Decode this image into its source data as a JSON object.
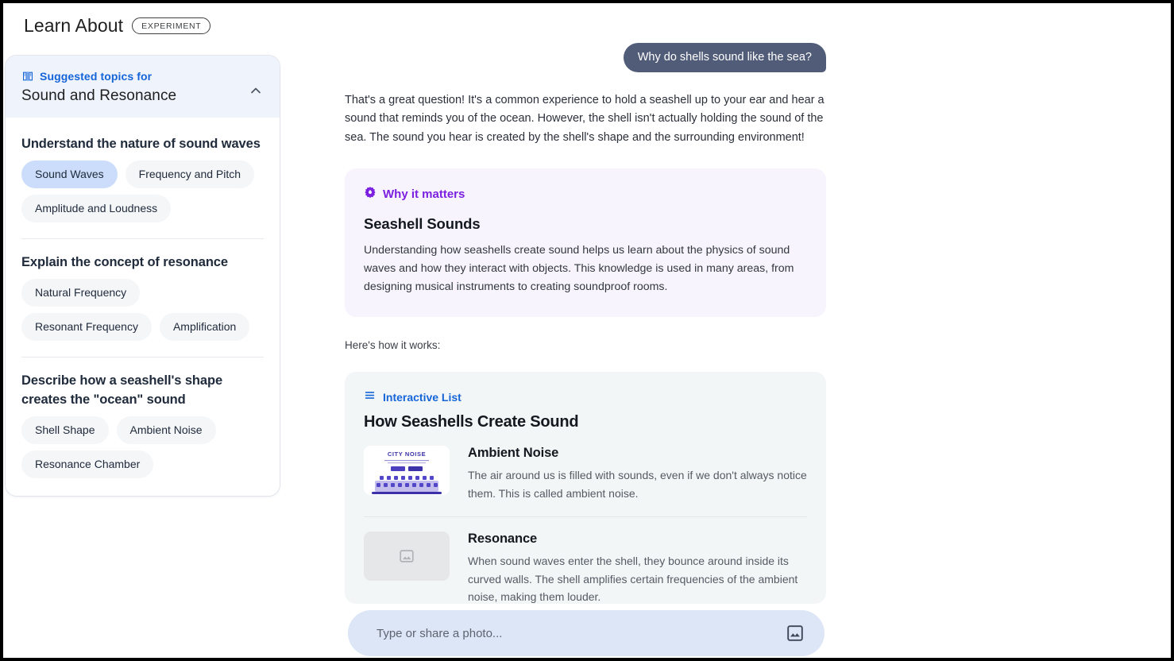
{
  "header": {
    "title": "Learn About",
    "badge": "EXPERIMENT"
  },
  "sidebar": {
    "eyebrow": "Suggested topics for",
    "eyebrow_icon": "menu-book-icon",
    "topic": "Sound and Resonance",
    "collapse_icon": "chevron-up-icon",
    "groups": [
      {
        "title": "Understand the nature of sound waves",
        "chips": [
          {
            "label": "Sound Waves",
            "selected": true
          },
          {
            "label": "Frequency and Pitch",
            "selected": false
          },
          {
            "label": "Amplitude and Loudness",
            "selected": false
          }
        ]
      },
      {
        "title": "Explain the concept of resonance",
        "chips": [
          {
            "label": "Natural Frequency",
            "selected": false
          },
          {
            "label": "Resonant Frequency",
            "selected": false
          },
          {
            "label": "Amplification",
            "selected": false
          }
        ]
      },
      {
        "title": "Describe how a seashell's shape creates the \"ocean\" sound",
        "chips": [
          {
            "label": "Shell Shape",
            "selected": false
          },
          {
            "label": "Ambient Noise",
            "selected": false
          },
          {
            "label": "Resonance Chamber",
            "selected": false
          }
        ]
      }
    ]
  },
  "conversation": {
    "user_message": "Why do shells sound like the sea?",
    "assistant_intro": "That's a great question! It's a common experience to hold a seashell up to your ear and hear a sound that reminds you of the ocean. However, the shell isn't actually holding the sound of the sea. The sound you hear is created by the shell's shape and the surrounding environment!",
    "transition": "Here's how it works:"
  },
  "why_card": {
    "eyebrow": "Why it matters",
    "eyebrow_icon": "starburst-icon",
    "title": "Seashell Sounds",
    "body": "Understanding how seashells create sound helps us learn about the physics of sound waves and how they interact with objects. This knowledge is used in many areas, from designing musical instruments to creating soundproof rooms."
  },
  "list_card": {
    "eyebrow": "Interactive List",
    "eyebrow_icon": "list-icon",
    "title": "How Seashells Create Sound",
    "items": [
      {
        "title": "Ambient Noise",
        "description": "The air around us is filled with sounds, even if we don't always notice them. This is called ambient noise.",
        "thumbnail_kind": "photo",
        "thumbnail_caption": "CITY NOISE"
      },
      {
        "title": "Resonance",
        "description": "When sound waves enter the shell, they bounce around inside its curved walls. The shell amplifies certain frequencies of the ambient noise, making them louder.",
        "thumbnail_kind": "placeholder",
        "thumbnail_caption": ""
      }
    ]
  },
  "composer": {
    "value": "",
    "placeholder": "Type or share a photo...",
    "attach_icon": "image-icon"
  },
  "colors": {
    "accent_blue": "#1565d8",
    "accent_purple": "#7b1fe0",
    "user_bubble": "#515c79",
    "chip_selected": "#ccddfb",
    "composer_bg": "#dde6f7"
  }
}
